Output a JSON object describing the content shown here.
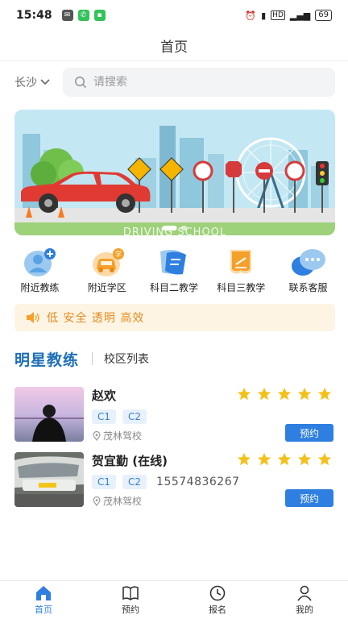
{
  "status_bar": {
    "time": "15:48",
    "battery": "69"
  },
  "header": {
    "title": "首页"
  },
  "search": {
    "city": "长沙",
    "placeholder": "请搜索"
  },
  "banner": {
    "caption": "DRIVING SCHOOL"
  },
  "quick_nav": [
    {
      "label": "附近教练",
      "icon": "coach-icon"
    },
    {
      "label": "附近学区",
      "icon": "school-car-icon"
    },
    {
      "label": "科目二教学",
      "icon": "subject-two-icon"
    },
    {
      "label": "科目三教学",
      "icon": "subject-three-icon"
    },
    {
      "label": "联系客服",
      "icon": "customer-service-icon"
    }
  ],
  "notice": {
    "text": "低 安全 透明 高效"
  },
  "section": {
    "active_tab": "明星教练",
    "inactive_tab": "校区列表"
  },
  "coaches": [
    {
      "name": "赵欢",
      "tags": [
        "C1",
        "C2"
      ],
      "phone": "",
      "school": "茂林驾校",
      "rating": 5,
      "book_label": "预约"
    },
    {
      "name": "贺宜勤 (在线)",
      "tags": [
        "C1",
        "C2"
      ],
      "phone": "15574836267",
      "school": "茂林驾校",
      "rating": 5,
      "book_label": "预约"
    }
  ],
  "tabbar": [
    {
      "label": "首页",
      "icon": "home-icon",
      "active": true
    },
    {
      "label": "预约",
      "icon": "book-icon",
      "active": false
    },
    {
      "label": "报名",
      "icon": "clock-icon",
      "active": false
    },
    {
      "label": "我的",
      "icon": "user-icon",
      "active": false
    }
  ],
  "colors": {
    "primary": "#2e7fe0",
    "section_title": "#1e6fb8",
    "notice_text": "#e28b1e",
    "star": "#f4c11a"
  }
}
